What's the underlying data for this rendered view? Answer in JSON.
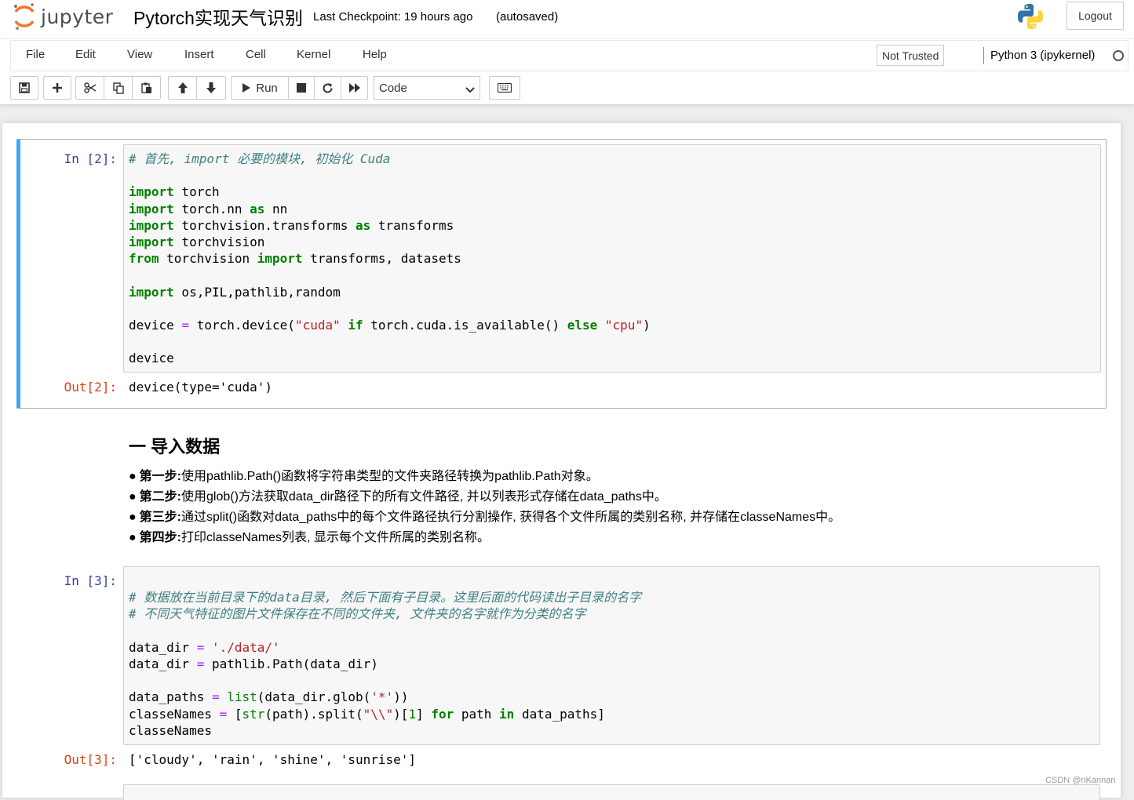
{
  "header": {
    "logo_text": "jupyter",
    "notebook_name": "Pytorch实现天气识别",
    "checkpoint_text": "Last Checkpoint: 19 hours ago",
    "autosave_text": "(autosaved)",
    "logout_label": "Logout"
  },
  "menubar": {
    "items": [
      {
        "label": "File"
      },
      {
        "label": "Edit"
      },
      {
        "label": "View"
      },
      {
        "label": "Insert"
      },
      {
        "label": "Cell"
      },
      {
        "label": "Kernel"
      },
      {
        "label": "Help"
      }
    ],
    "trust_label": "Not Trusted",
    "kernel_name": "Python 3 (ipykernel)"
  },
  "toolbar": {
    "icons": [
      "save-icon",
      "plus-icon",
      "cut-icon",
      "copy-icon",
      "paste-icon",
      "arrow-up-icon",
      "arrow-down-icon",
      "play-icon",
      "stop-icon",
      "restart-icon",
      "fast-forward-icon",
      "keyboard-icon"
    ],
    "run_label": "Run",
    "cell_type": "Code"
  },
  "cells": [
    {
      "prompt_in": "In [2]:",
      "prompt_out": "Out[2]:",
      "code_lines": [
        "# 首先, import 必要的模块, 初始化 Cuda",
        "",
        "import torch",
        "import torch.nn as nn",
        "import torchvision.transforms as transforms",
        "import torchvision",
        "from torchvision import transforms, datasets",
        "",
        "import os,PIL,pathlib,random",
        "",
        "device = torch.device(\"cuda\" if torch.cuda.is_available() else \"cpu\")",
        "",
        "device"
      ],
      "output": "device(type='cuda')"
    },
    {
      "prompt_in": "In [3]:",
      "prompt_out": "Out[3]:",
      "code_lines": [
        "",
        "# 数据放在当前目录下的data目录, 然后下面有子目录。这里后面的代码读出子目录的名字",
        "# 不同天气特征的图片文件保存在不同的文件夹, 文件夹的名字就作为分类的名字",
        "",
        "data_dir = './data/'",
        "data_dir = pathlib.Path(data_dir)",
        "",
        "data_paths = list(data_dir.glob('*'))",
        "classeNames = [str(path).split(\"\\\\\")[1] for path in data_paths]",
        "classeNames"
      ],
      "output": "['cloudy', 'rain', 'shine', 'sunrise']"
    }
  ],
  "markdown": {
    "title": "一 导入数据",
    "steps": [
      {
        "bullet": "●",
        "label": "第一步:",
        "text": "使用pathlib.Path()函数将字符串类型的文件夹路径转换为pathlib.Path对象。"
      },
      {
        "bullet": "●",
        "label": "第二步:",
        "text": "使用glob()方法获取data_dir路径下的所有文件路径, 并以列表形式存储在data_paths中。"
      },
      {
        "bullet": "●",
        "label": "第三步:",
        "text": "通过split()函数对data_paths中的每个文件路径执行分割操作, 获得各个文件所属的类别名称, 并存储在classeNames中。"
      },
      {
        "bullet": "●",
        "label": "第四步:",
        "text": "打印classeNames列表, 显示每个文件所属的类别名称。"
      }
    ]
  },
  "watermark": "CSDN @nKannan",
  "colors": {
    "selected_cell_border": "#42a5f5",
    "prompt_in": "#303f9f",
    "prompt_out": "#d84315",
    "keyword": "#008000",
    "comment": "#408080",
    "string": "#ba2121",
    "operator": "#aa22ff"
  }
}
